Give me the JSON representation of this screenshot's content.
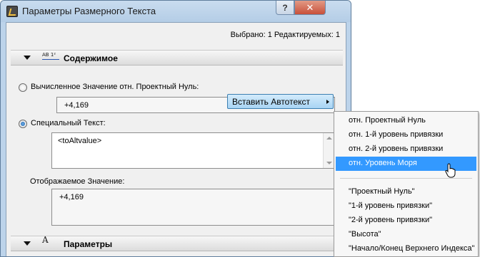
{
  "window": {
    "title": "Параметры Размерного Текста",
    "help_label": "?",
    "close_label": "✕"
  },
  "selection_info": "Выбрано: 1 Редактируемых: 1",
  "contents_section": {
    "title": "Содержимое",
    "icon_text": "AB 1²",
    "icon": "dimension-text-icon"
  },
  "calculated": {
    "label": "Вычисленное Значение отн. Проектный Нуль:",
    "value": "+4,169",
    "selected": false
  },
  "custom": {
    "label": "Специальный Текст:",
    "selected": true,
    "text": "<toAltvalue>",
    "insert_button": "Вставить Автотекст"
  },
  "displayed": {
    "label": "Отображаемое Значение:",
    "value": "+4,169"
  },
  "params_section": {
    "title": "Параметры",
    "icon": "text-style-icon"
  },
  "menu": {
    "items_group1": [
      "отн. Проектный Нуль",
      "отн. 1-й уровень привязки",
      "отн. 2-й уровень привязки",
      "отн. Уровень Моря"
    ],
    "highlighted": "отн. Уровень Моря",
    "items_group2": [
      "\"Проектный Нуль\"",
      "\"1-й уровень привязки\"",
      "\"2-й уровень привязки\"",
      "\"Высота\"",
      "\"Начало/Конец Верхнего Индекса\""
    ]
  },
  "colors": {
    "titlebar": "#bcd3ea",
    "highlight": "#3399ff",
    "button": "#a8d4f4",
    "close": "#c8503a"
  }
}
